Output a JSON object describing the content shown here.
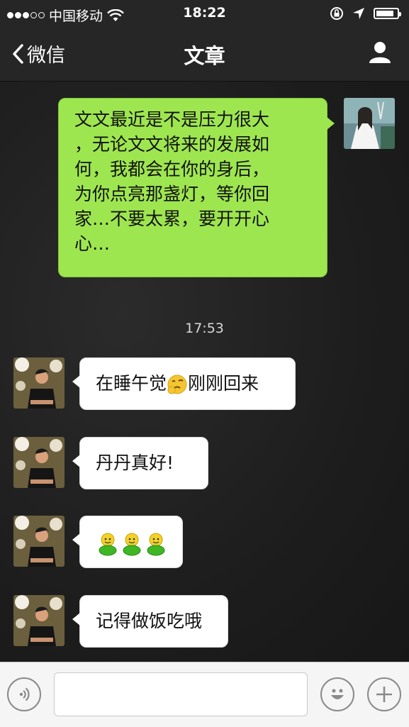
{
  "status_bar": {
    "carrier": "中国移动",
    "time": "18:22"
  },
  "nav": {
    "back_label": "微信",
    "title": "文章"
  },
  "messages": [
    {
      "side": "out",
      "text": "文文最近是不是压力很大，无论文文将来的发展如何，我都会在你的身后，为你点亮那盏灯，等你回家…不要太累，要开开心心…",
      "lines": [
        "文文最近是不是压力很大",
        "，无论文文将来的发展如",
        "何，我都会在你的身后，",
        "为你点亮那盏灯，等你回",
        "家…不要太累，要开开心",
        "心…"
      ]
    },
    {
      "side": "time",
      "text": "17:53"
    },
    {
      "side": "in",
      "text_before": "在睡午觉",
      "emoji": "thinking-face",
      "text_after": "刚刚回来"
    },
    {
      "side": "in",
      "text": "丹丹真好!"
    },
    {
      "side": "in",
      "emojis": [
        "green-smiley",
        "green-smiley",
        "green-smiley"
      ]
    },
    {
      "side": "in",
      "text": "记得做饭吃哦"
    }
  ],
  "colors": {
    "outgoing_bubble": "#9ee650",
    "incoming_bubble": "#ffffff",
    "bar_background": "#262626",
    "input_bar_background": "#f5f5f5"
  }
}
